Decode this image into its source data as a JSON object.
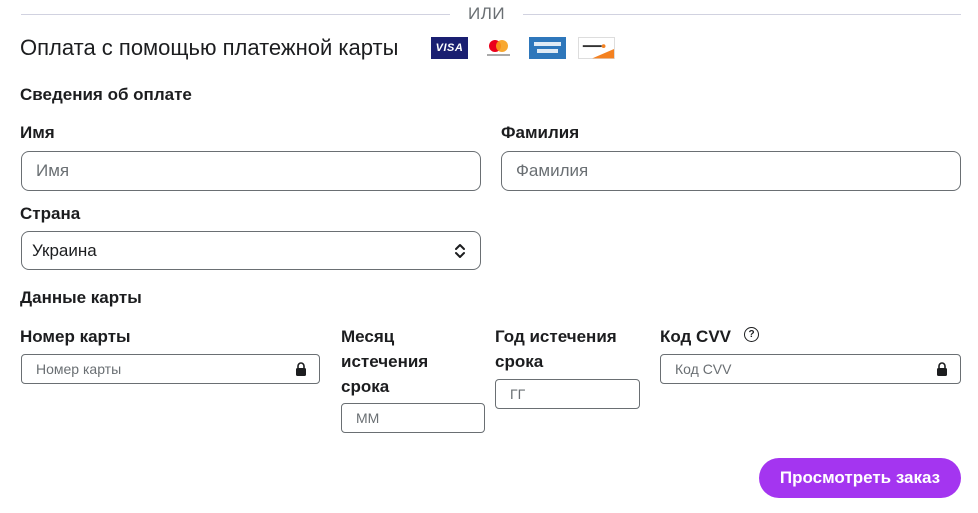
{
  "divider": {
    "text": "ИЛИ"
  },
  "payment": {
    "title": "Оплата с помощью платежной карты",
    "card_logos": [
      {
        "name": "visa",
        "text": "VISA",
        "color": "#1a1f71"
      },
      {
        "name": "mastercard",
        "text": "mastercard"
      },
      {
        "name": "american-express",
        "text": "AMERICAN EXPRESS",
        "color": "#2e77bb"
      },
      {
        "name": "discover",
        "text": "DISCOVER",
        "color": "#f48120"
      }
    ]
  },
  "billing": {
    "heading": "Сведения об оплате",
    "first_name": {
      "label": "Имя",
      "placeholder": "Имя"
    },
    "last_name": {
      "label": "Фамилия",
      "placeholder": "Фамилия"
    },
    "country": {
      "label": "Страна",
      "value": "Украина"
    }
  },
  "card": {
    "heading": "Данные карты",
    "number": {
      "label": "Номер карты",
      "placeholder": "Номер карты"
    },
    "month": {
      "label": "Месяц истечения срока",
      "placeholder": "ММ"
    },
    "year": {
      "label": "Год истечения срока",
      "placeholder": "ГГ"
    },
    "cvv": {
      "label": "Код CVV",
      "placeholder": "Код CVV",
      "help_glyph": "?"
    }
  },
  "actions": {
    "review_label": "Просмотреть заказ"
  },
  "colors": {
    "accent": "#a435f0",
    "border": "#6a6f73",
    "text": "#1c1d1f"
  }
}
